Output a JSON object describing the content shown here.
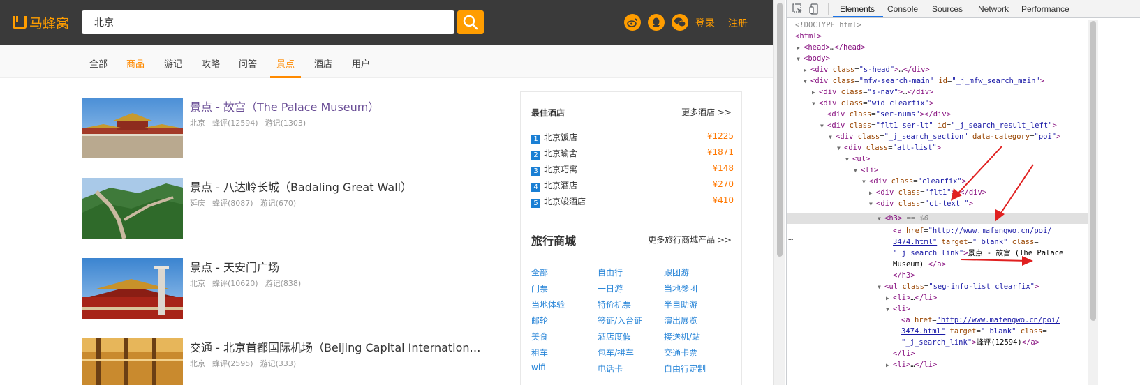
{
  "site": {
    "logo_text": "马蜂窝",
    "search_value": "北京",
    "login": "登录",
    "register": "注册",
    "nav": [
      "全部",
      "商品",
      "游记",
      "攻略",
      "问答",
      "景点",
      "酒店",
      "用户"
    ],
    "results": [
      {
        "title": "景点 - 故宫（The Palace Museum）",
        "city": "北京",
        "reviews": "蜂评(12594)",
        "notes": "游记(1303)"
      },
      {
        "title": "景点 - 八达岭长城（Badaling Great Wall）",
        "city": "延庆",
        "reviews": "蜂评(8087)",
        "notes": "游记(670)"
      },
      {
        "title": "景点 - 天安门广场",
        "city": "北京",
        "reviews": "蜂评(10620)",
        "notes": "游记(838)"
      },
      {
        "title": "交通 - 北京首都国际机场（Beijing Capital Internation…",
        "city": "北京",
        "reviews": "蜂评(2595)",
        "notes": "游记(333)"
      }
    ],
    "sidebar": {
      "hotels_title": "最佳酒店",
      "hotels_more": "更多酒店 >>",
      "hotels": [
        {
          "num": "1",
          "name": "北京饭店",
          "price": "¥1225"
        },
        {
          "num": "2",
          "name": "北京瑜舍",
          "price": "¥1871"
        },
        {
          "num": "3",
          "name": "北京巧寓",
          "price": "¥148"
        },
        {
          "num": "4",
          "name": "北京酒店",
          "price": "¥270"
        },
        {
          "num": "5",
          "name": "北京竣酒店",
          "price": "¥410"
        }
      ],
      "mall_title": "旅行商城",
      "mall_more": "更多旅行商城产品 >>",
      "mall_links": [
        [
          "全部",
          "自由行",
          "跟团游"
        ],
        [
          "门票",
          "一日游",
          "当地参团"
        ],
        [
          "当地体验",
          "特价机票",
          "半自助游"
        ],
        [
          "邮轮",
          "签证/入台证",
          "演出展览"
        ],
        [
          "美食",
          "酒店度假",
          "接送机/站"
        ],
        [
          "租车",
          "包车/拼车",
          "交通卡票"
        ],
        [
          "wifi",
          "电话卡",
          "自由行定制"
        ]
      ]
    }
  },
  "devtools": {
    "tabs": [
      "Elements",
      "Console",
      "Sources",
      "Network",
      "Performance"
    ],
    "active_tab": "Elements",
    "selected_marker": "== $0",
    "dom": {
      "doctype": "<!DOCTYPE html>",
      "html": "html",
      "head": "head",
      "body": "body",
      "div": "div",
      "ul": "ul",
      "li": "li",
      "h3": "h3",
      "a": "a",
      "class_attr": "class",
      "id_attr": "id",
      "href_attr": "href",
      "target_attr": "target",
      "data_category_attr": "data-category",
      "s_head": "\"s-head\"",
      "mfw_search_main": "\"mfw-search-main\"",
      "j_mfw_search_main": "\"_j_mfw_search_main\"",
      "s_nav": "\"s-nav\"",
      "wid_clearfix": "\"wid clearfix\"",
      "ser_nums": "\"ser-nums\"",
      "flt1_ser_lt": "\"flt1 ser-lt\"",
      "j_search_result_left": "\"_j_search_result_left\"",
      "j_search_section": "\"_j_search_section\"",
      "poi": "\"poi\"",
      "att_list": "\"att-list\"",
      "clearfix": "\"clearfix\"",
      "flt1": "\"flt1\"",
      "ct_text": "\"ct-text \"",
      "href_url_1": "\"http://www.mafengwo.cn/poi/",
      "href_url_2": "3474.html\"",
      "blank": "\"_blank\"",
      "j_search_link": "\"_j_search_link\"",
      "link_text_1": "景点 - 故宫 (The Palace",
      "link_text_2": "Museum) ",
      "seg_info_list": "\"seg-info-list clearfix\"",
      "li_text": "蜂评(12594)"
    }
  }
}
